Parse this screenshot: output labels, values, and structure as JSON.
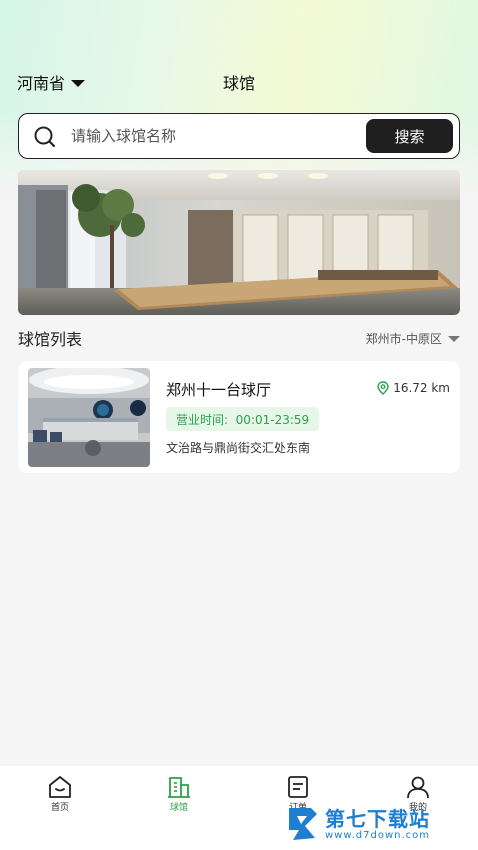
{
  "header": {
    "province": "河南省",
    "title": "球馆"
  },
  "search": {
    "placeholder": "请输入球馆名称",
    "button_label": "搜索"
  },
  "section": {
    "title": "球馆列表",
    "district_filter": "郑州市-中原区"
  },
  "venues": [
    {
      "name": "郑州十一台球厅",
      "distance": "16.72 km",
      "hours": "营业时间:  00:01-23:59",
      "address": "文治路与鼎尚街交汇处东南"
    }
  ],
  "tabbar": {
    "items": [
      {
        "label": "首页",
        "icon": "home-icon"
      },
      {
        "label": "球馆",
        "icon": "venue-icon",
        "active": true
      },
      {
        "label": "订单",
        "icon": "order-icon"
      },
      {
        "label": "我的",
        "icon": "profile-icon"
      }
    ]
  },
  "watermark": {
    "title": "第七下载站",
    "url": "www.d7down.com"
  },
  "colors": {
    "accent_green": "#2aa24a",
    "search_button": "#1f1f1f",
    "watermark_blue": "#1e7fd0"
  }
}
